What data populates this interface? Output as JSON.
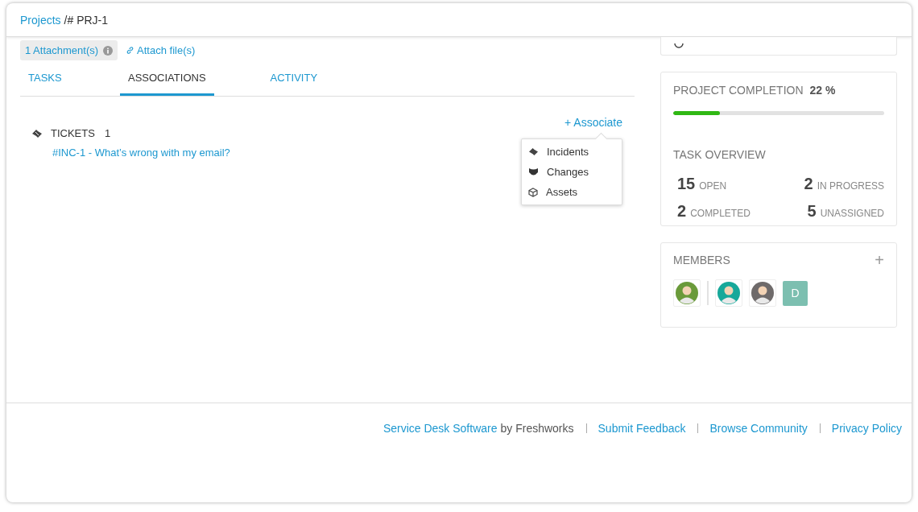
{
  "breadcrumb": {
    "parent": "Projects",
    "current": "/# PRJ-1"
  },
  "attachments": {
    "count_label": "1 Attachment(s)",
    "attach_link": "Attach file(s)"
  },
  "tabs": [
    {
      "label": "TASKS",
      "selected": false
    },
    {
      "label": "ASSOCIATIONS",
      "selected": true
    },
    {
      "label": "ACTIVITY",
      "selected": false
    }
  ],
  "associations": {
    "heading": "TICKETS",
    "count": "1",
    "items": [
      "#INC-1 - What’s wrong with my email?"
    ],
    "associate_button": "+ Associate",
    "menu": [
      {
        "label": "Incidents",
        "kind": "incident"
      },
      {
        "label": "Changes",
        "kind": "change"
      },
      {
        "label": "Assets",
        "kind": "asset"
      }
    ]
  },
  "completion": {
    "label": "PROJECT COMPLETION",
    "percent": "22 %",
    "level": 0.22
  },
  "task_overview": {
    "title": "TASK OVERVIEW",
    "stats": [
      {
        "count": "15",
        "label": "OPEN"
      },
      {
        "count": "2",
        "label": "IN PROGRESS"
      },
      {
        "count": "2",
        "label": "COMPLETED"
      },
      {
        "count": "5",
        "label": "UNASSIGNED"
      }
    ]
  },
  "members": {
    "title": "MEMBERS",
    "add": "+",
    "people": [
      {
        "kind": "avatar",
        "color": "#6a9a3a"
      },
      {
        "kind": "avatar",
        "color": "#17a89a"
      },
      {
        "kind": "avatar",
        "color": "#6e6a6a"
      },
      {
        "kind": "initial",
        "initial": "D",
        "color": "#7cbfb0"
      }
    ]
  },
  "footer": {
    "product_link": "Service Desk Software",
    "by_text": "by Freshworks",
    "links": [
      "Submit Feedback",
      "Browse Community",
      "Privacy Policy"
    ]
  }
}
